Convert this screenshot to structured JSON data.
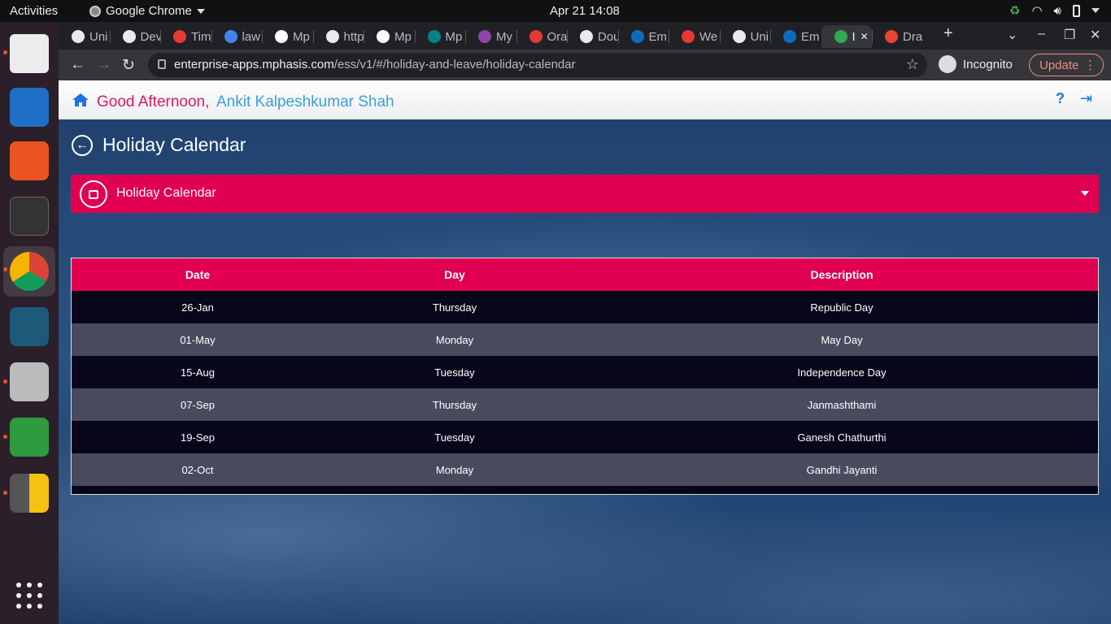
{
  "topbar": {
    "activities": "Activities",
    "app_name": "Google Chrome",
    "clock": "Apr 21  14:08"
  },
  "tabs": [
    {
      "label": "Uni",
      "icon": "globe-icon"
    },
    {
      "label": "Dev",
      "icon": "globe-icon"
    },
    {
      "label": "Tim",
      "icon": "oracle-icon"
    },
    {
      "label": "law",
      "icon": "google-icon"
    },
    {
      "label": "Mp",
      "icon": "a-icon"
    },
    {
      "label": "http",
      "icon": "globe-icon"
    },
    {
      "label": "Mp",
      "icon": "a-icon"
    },
    {
      "label": "Mp",
      "icon": "sharepoint-icon"
    },
    {
      "label": "My",
      "icon": "mphasis-icon"
    },
    {
      "label": "Ora",
      "icon": "oracle-icon"
    },
    {
      "label": "Dou",
      "icon": "globe-icon"
    },
    {
      "label": "Em",
      "icon": "outlook-icon"
    },
    {
      "label": "We",
      "icon": "oracle-icon"
    },
    {
      "label": "Uni",
      "icon": "globe-icon"
    },
    {
      "label": "Em",
      "icon": "outlook-icon"
    },
    {
      "label": "I",
      "icon": "app-icon"
    },
    {
      "label": "Dra",
      "icon": "gmail-icon"
    }
  ],
  "toolbar": {
    "url_host": "enterprise-apps.mphasis.com",
    "url_path": "/ess/v1/#/holiday-and-leave/holiday-calendar",
    "incognito_label": "Incognito",
    "update_label": "Update"
  },
  "header": {
    "greeting": "Good Afternoon,",
    "user_name": "Ankit Kalpeshkumar Shah",
    "help": "?"
  },
  "page": {
    "title": "Holiday Calendar",
    "accordion_label": "Holiday Calendar"
  },
  "table": {
    "headers": [
      "Date",
      "Day",
      "Description"
    ],
    "rows": [
      {
        "date": "26-Jan",
        "day": "Thursday",
        "description": "Republic Day"
      },
      {
        "date": "01-May",
        "day": "Monday",
        "description": "May Day"
      },
      {
        "date": "15-Aug",
        "day": "Tuesday",
        "description": "Independence Day"
      },
      {
        "date": "07-Sep",
        "day": "Thursday",
        "description": "Janmashthami"
      },
      {
        "date": "19-Sep",
        "day": "Tuesday",
        "description": "Ganesh Chathurthi"
      },
      {
        "date": "02-Oct",
        "day": "Monday",
        "description": "Gandhi Jayanti"
      }
    ]
  },
  "colors": {
    "brand_pink": "#e0004f",
    "greeting_pink": "#d81b60",
    "username_blue": "#3aa0d8"
  }
}
